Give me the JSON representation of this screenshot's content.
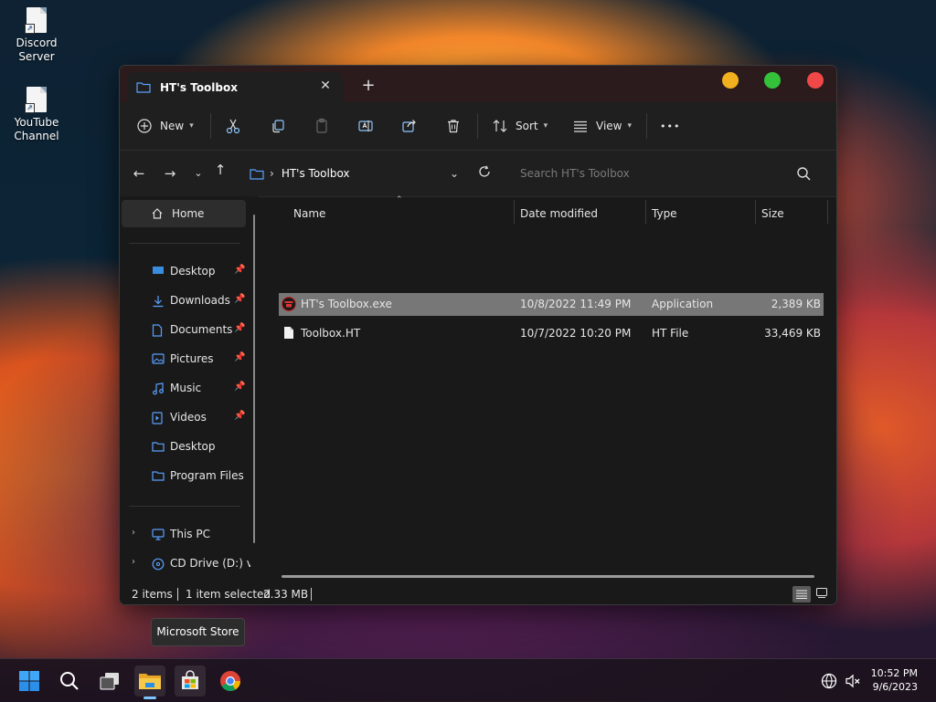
{
  "desktop": {
    "icons": [
      {
        "line1": "Discord",
        "line2": "Server"
      },
      {
        "line1": "YouTube",
        "line2": "Channel"
      }
    ]
  },
  "window": {
    "tab_title": "HT's Toolbox",
    "tab_close": "✕",
    "new_tab": "+",
    "traffic_colors": [
      "#f2b01e",
      "#35c23b",
      "#f04848"
    ]
  },
  "toolbar": {
    "new_label": "New",
    "sort_label": "Sort",
    "view_label": "View",
    "more_label": "•••"
  },
  "address": {
    "breadcrumb_sep": "›",
    "folder": "HT's Toolbox",
    "search_placeholder": "Search HT's Toolbox"
  },
  "sidebar": {
    "home": "Home",
    "pinned": [
      {
        "label": "Desktop",
        "icon": "desktop-icon"
      },
      {
        "label": "Downloads",
        "icon": "download-icon"
      },
      {
        "label": "Documents",
        "icon": "document-icon"
      },
      {
        "label": "Pictures",
        "icon": "picture-icon"
      },
      {
        "label": "Music",
        "icon": "music-icon"
      },
      {
        "label": "Videos",
        "icon": "video-icon"
      }
    ],
    "folders": [
      {
        "label": "Desktop"
      },
      {
        "label": "Program Files"
      }
    ],
    "drives": [
      {
        "label": "This PC"
      },
      {
        "label": "CD Drive (D:) virtio-win"
      }
    ]
  },
  "columns": {
    "name": "Name",
    "date": "Date modified",
    "type": "Type",
    "size": "Size"
  },
  "files": [
    {
      "name": "HT's Toolbox.exe",
      "date": "10/8/2022 11:49 PM",
      "type": "Application",
      "size": "2,389 KB"
    },
    {
      "name": "Toolbox.HT",
      "date": "10/7/2022 10:20 PM",
      "type": "HT File",
      "size": "33,469 KB"
    }
  ],
  "status": {
    "count": "2 items",
    "selection": "1 item selected",
    "selection_size": "2.33 MB"
  },
  "tooltip": "Microsoft Store",
  "clock": {
    "time": "10:52 PM",
    "date": "9/6/2023"
  }
}
